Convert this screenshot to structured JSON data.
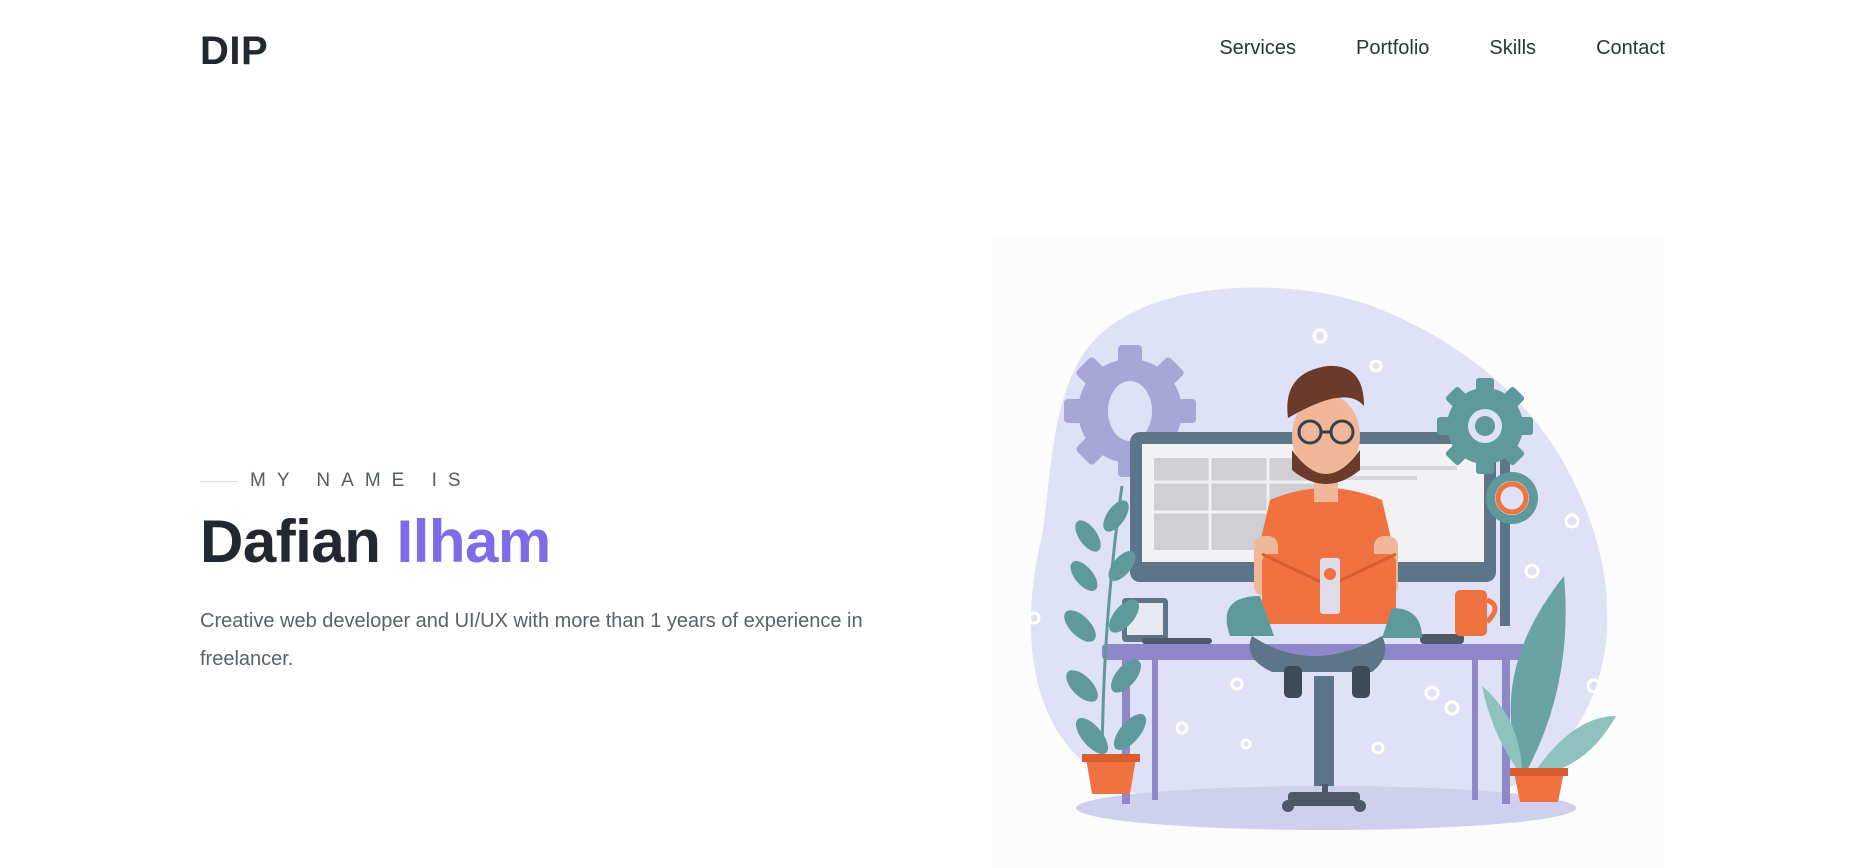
{
  "brand": {
    "logo": "DIP"
  },
  "nav": {
    "items": [
      {
        "label": "Services"
      },
      {
        "label": "Portfolio"
      },
      {
        "label": "Skills"
      },
      {
        "label": "Contact"
      }
    ]
  },
  "hero": {
    "eyebrow": "MY NAME IS",
    "first_name": "Dafian",
    "last_name": "Ilham",
    "description": "Creative web developer and UI/UX with more than 1 years of experience in freelancer.",
    "illustration_icon": "developer-at-desk-illustration"
  },
  "colors": {
    "accent": "#7d6ce8",
    "text_dark": "#222831",
    "text_muted": "#5b6168",
    "orange": "#f07241",
    "teal": "#5e9a9c",
    "lavender": "#a6a3d6"
  }
}
